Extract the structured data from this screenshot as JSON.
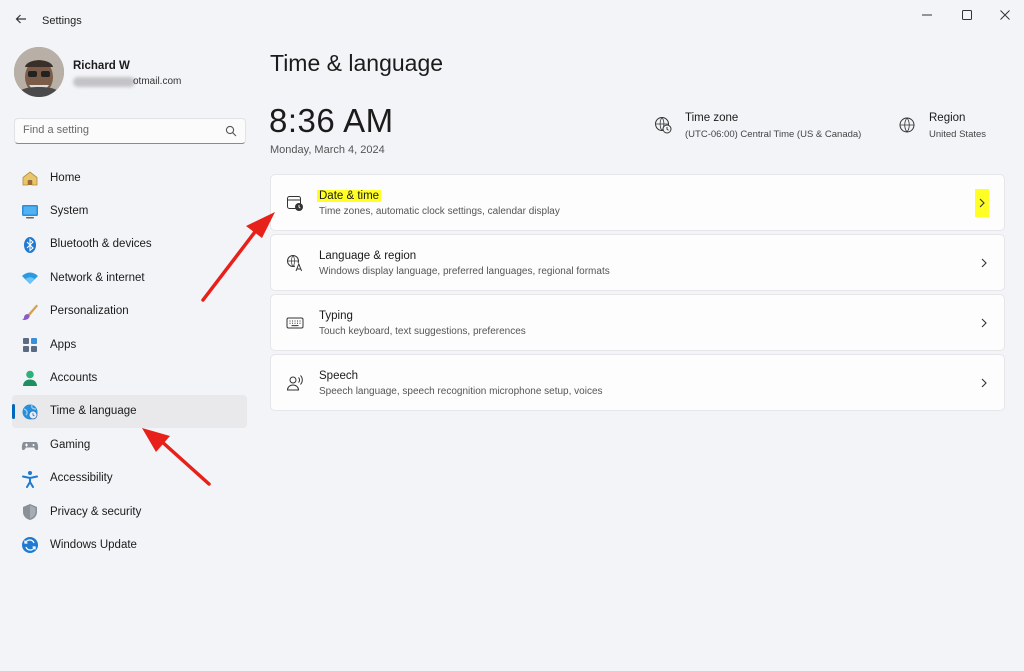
{
  "window": {
    "title": "Settings"
  },
  "profile": {
    "name": "Richard W",
    "email_visible": "otmail.com"
  },
  "search": {
    "placeholder": "Find a setting"
  },
  "sidebar": {
    "items": [
      {
        "label": "Home",
        "icon": "home-icon",
        "active": false
      },
      {
        "label": "System",
        "icon": "system-monitor-icon",
        "active": false
      },
      {
        "label": "Bluetooth & devices",
        "icon": "bluetooth-icon",
        "active": false
      },
      {
        "label": "Network & internet",
        "icon": "wifi-icon",
        "active": false
      },
      {
        "label": "Personalization",
        "icon": "brush-icon",
        "active": false
      },
      {
        "label": "Apps",
        "icon": "apps-icon",
        "active": false
      },
      {
        "label": "Accounts",
        "icon": "accounts-icon",
        "active": false
      },
      {
        "label": "Time & language",
        "icon": "globe-clock-icon",
        "active": true
      },
      {
        "label": "Gaming",
        "icon": "gamepad-icon",
        "active": false
      },
      {
        "label": "Accessibility",
        "icon": "accessibility-icon",
        "active": false
      },
      {
        "label": "Privacy & security",
        "icon": "shield-icon",
        "active": false
      },
      {
        "label": "Windows Update",
        "icon": "update-icon",
        "active": false
      }
    ]
  },
  "main": {
    "title": "Time & language",
    "time": "8:36 AM",
    "date": "Monday, March 4, 2024",
    "time_zone": {
      "title": "Time zone",
      "value": "(UTC-06:00) Central Time (US & Canada)"
    },
    "region": {
      "title": "Region",
      "value": "United States"
    },
    "cards": [
      {
        "title": "Date & time",
        "subtitle": "Time zones, automatic clock settings, calendar display",
        "icon": "calendar-clock-icon",
        "highlighted": true
      },
      {
        "title": "Language & region",
        "subtitle": "Windows display language, preferred languages, regional formats",
        "icon": "language-icon",
        "highlighted": false
      },
      {
        "title": "Typing",
        "subtitle": "Touch keyboard, text suggestions, preferences",
        "icon": "keyboard-icon",
        "highlighted": false
      },
      {
        "title": "Speech",
        "subtitle": "Speech language, speech recognition microphone setup, voices",
        "icon": "speech-icon",
        "highlighted": false
      }
    ]
  },
  "colors": {
    "accent": "#0067c0",
    "highlight": "#ffff26",
    "annotation_arrow": "#e8201a",
    "background": "#f3f4f7"
  }
}
